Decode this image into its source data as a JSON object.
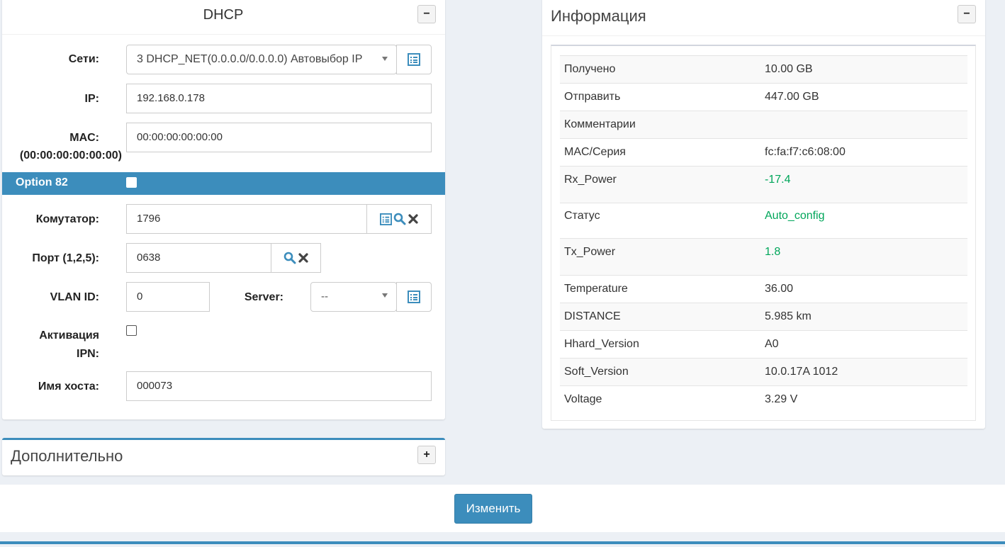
{
  "dhcp": {
    "title": "DHCP",
    "collapse_label": "−",
    "network_label": "Сети:",
    "network_value": "3 DHCP_NET(0.0.0.0/0.0.0.0) Автовыбор IP",
    "ip_label": "IP:",
    "ip_value": "192.168.0.178",
    "mac_label_line1": "MAC:",
    "mac_label_line2": "(00:00:00:00:00:00)",
    "mac_value": "00:00:00:00:00:00",
    "option82_label": "Option 82",
    "switch_label": "Комутатор:",
    "switch_value": "1796",
    "port_label": "Порт (1,2,5):",
    "port_value": "0638",
    "vlan_label": "VLAN ID:",
    "vlan_value": "0",
    "server_label": "Server:",
    "server_value": "--",
    "activation_label_line1": "Активация",
    "activation_label_line2": "IPN:",
    "hostname_label": "Имя хоста:",
    "hostname_value": "000073",
    "accent_color": "#3c8dbc"
  },
  "extra": {
    "title": "Дополнительно",
    "expand_label": "+"
  },
  "info": {
    "title": "Информация",
    "collapse_label": "−",
    "rows": [
      {
        "key": "Получено",
        "value": "10.00 GB"
      },
      {
        "key": "Отправить",
        "value": "447.00 GB"
      },
      {
        "key": "Комментарии",
        "value": ""
      },
      {
        "key": "MAC/Серия",
        "value": "fc:fa:f7:c6:08:00"
      },
      {
        "key": "Rx_Power",
        "value": "-17.4"
      },
      {
        "key": "Статус",
        "value": "Auto_config"
      },
      {
        "key": "Tx_Power",
        "value": "1.8"
      },
      {
        "key": "Temperature",
        "value": "36.00"
      },
      {
        "key": "DISTANCE",
        "value": "5.985 km"
      },
      {
        "key": "Hhard_Version",
        "value": "A0"
      },
      {
        "key": "Soft_Version",
        "value": "10.0.17A 1012"
      },
      {
        "key": "Voltage",
        "value": "3.29 V"
      }
    ],
    "status_color": "#00a65a"
  },
  "footer": {
    "submit_label": "Изменить",
    "button_color": "#3c8dbc"
  }
}
